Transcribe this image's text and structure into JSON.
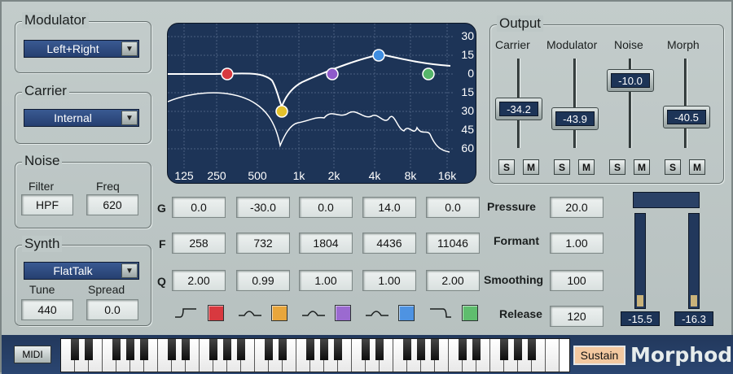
{
  "modulator": {
    "title": "Modulator",
    "source": "Left+Right"
  },
  "carrier": {
    "title": "Carrier",
    "source": "Internal"
  },
  "noise": {
    "title": "Noise",
    "filter_label": "Filter",
    "filter_value": "HPF",
    "freq_label": "Freq",
    "freq_value": "620"
  },
  "synth": {
    "title": "Synth",
    "preset": "FlatTalk",
    "tune_label": "Tune",
    "tune_value": "440",
    "spread_label": "Spread",
    "spread_value": "0.0"
  },
  "eq_display": {
    "db_ticks": [
      "30",
      "15",
      "0",
      "15",
      "30",
      "45",
      "60"
    ],
    "freq_ticks": [
      "125",
      "250",
      "500",
      "1k",
      "2k",
      "4k",
      "8k",
      "16k"
    ],
    "handle_colors": [
      "#d8393f",
      "#e4c22c",
      "#8e5acb",
      "#3f8de0",
      "#56b56a"
    ]
  },
  "bands": {
    "row_labels": [
      "G",
      "F",
      "Q"
    ],
    "gain": [
      "0.0",
      "-30.0",
      "0.0",
      "14.0",
      "0.0"
    ],
    "freq": [
      "258",
      "732",
      "1804",
      "4436",
      "11046"
    ],
    "q": [
      "2.00",
      "0.99",
      "1.00",
      "1.00",
      "2.00"
    ],
    "shapes": [
      "high-pass-shape-icon",
      "peak-shape-icon",
      "peak-shape-icon",
      "peak-shape-icon",
      "low-pass-shape-icon"
    ],
    "colors": [
      "#d8393f",
      "#e8a63c",
      "#9b6ad0",
      "#4e93e2",
      "#5fbd6e"
    ]
  },
  "params": {
    "pressure_label": "Pressure",
    "pressure_value": "20.0",
    "formant_label": "Formant",
    "formant_value": "1.00",
    "smoothing_label": "Smoothing",
    "smoothing_value": "100",
    "release_label": "Release",
    "release_value": "120"
  },
  "output": {
    "title": "Output",
    "channels": [
      {
        "label": "Carrier",
        "value": "-34.2",
        "solo": "S",
        "mute": "M"
      },
      {
        "label": "Modulator",
        "value": "-43.9",
        "solo": "S",
        "mute": "M"
      },
      {
        "label": "Noise",
        "value": "-10.0",
        "solo": "S",
        "mute": "M"
      },
      {
        "label": "Morph",
        "value": "-40.5",
        "solo": "S",
        "mute": "M"
      }
    ]
  },
  "meters": {
    "left": "-15.5",
    "right": "-16.3"
  },
  "footer": {
    "midi_label": "MIDI",
    "sustain_label": "Sustain",
    "brand": "Morphoder"
  }
}
